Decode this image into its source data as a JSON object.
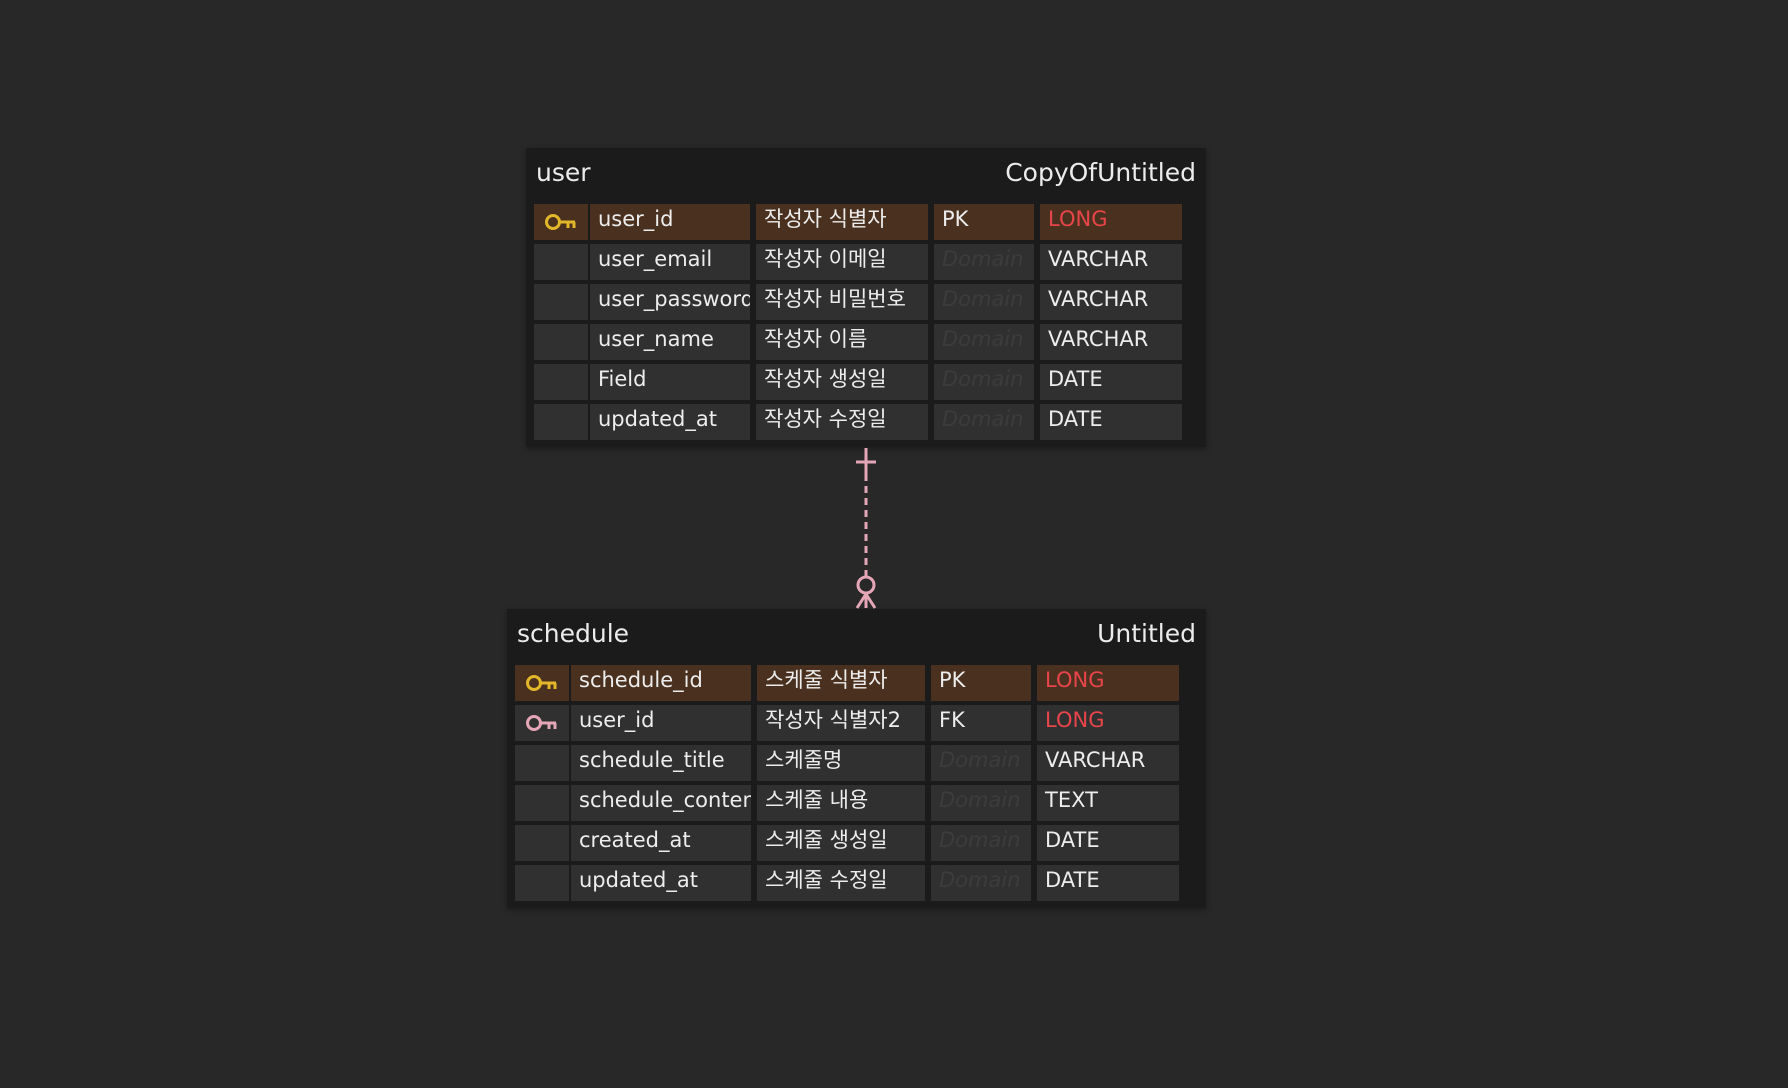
{
  "entities": {
    "user": {
      "name": "user",
      "schema": "CopyOfUntitled",
      "columns": [
        {
          "key": "pk",
          "key_icon": "primary-key-icon",
          "name": "user_id",
          "comment": "작성자 식별자",
          "constraint": "PK",
          "type": "LONG"
        },
        {
          "key": "",
          "name": "user_email",
          "comment": "작성자 이메일",
          "constraint": "Domain",
          "type": "VARCHAR"
        },
        {
          "key": "",
          "name": "user_password",
          "comment": "작성자 비밀번호",
          "constraint": "Domain",
          "type": "VARCHAR"
        },
        {
          "key": "",
          "name": "user_name",
          "comment": "작성자 이름",
          "constraint": "Domain",
          "type": "VARCHAR"
        },
        {
          "key": "",
          "name": "Field",
          "comment": "작성자 생성일",
          "constraint": "Domain",
          "type": "DATE"
        },
        {
          "key": "",
          "name": "updated_at",
          "comment": "작성자 수정일",
          "constraint": "Domain",
          "type": "DATE"
        }
      ]
    },
    "schedule": {
      "name": "schedule",
      "schema": "Untitled",
      "columns": [
        {
          "key": "pk",
          "key_icon": "primary-key-icon",
          "name": "schedule_id",
          "comment": "스케줄 식별자",
          "constraint": "PK",
          "type": "LONG"
        },
        {
          "key": "fk",
          "key_icon": "foreign-key-icon",
          "name": "user_id",
          "comment": "작성자 식별자2",
          "constraint": "FK",
          "type": "LONG"
        },
        {
          "key": "",
          "name": "schedule_title",
          "comment": "스케줄명",
          "constraint": "Domain",
          "type": "VARCHAR"
        },
        {
          "key": "",
          "name": "schedule_content",
          "comment": "스케줄 내용",
          "constraint": "Domain",
          "type": "TEXT"
        },
        {
          "key": "",
          "name": "created_at",
          "comment": "스케줄 생성일",
          "constraint": "Domain",
          "type": "DATE"
        },
        {
          "key": "",
          "name": "updated_at",
          "comment": "스케줄 수정일",
          "constraint": "Domain",
          "type": "DATE"
        }
      ]
    }
  },
  "relationship": {
    "from": "user",
    "to": "schedule",
    "from_cardinality": "exactly-one",
    "to_cardinality": "zero-or-many",
    "line_style": "dashed",
    "color": "#e5a7b8"
  },
  "colors": {
    "background": "#282828",
    "entity_background": "#1b1b1b",
    "cell_background": "#303030",
    "pk_row_background": "#4a311f",
    "long_type": "#e8454b",
    "pk_key": "#e3b72a",
    "fk_key": "#e5a7b8"
  }
}
